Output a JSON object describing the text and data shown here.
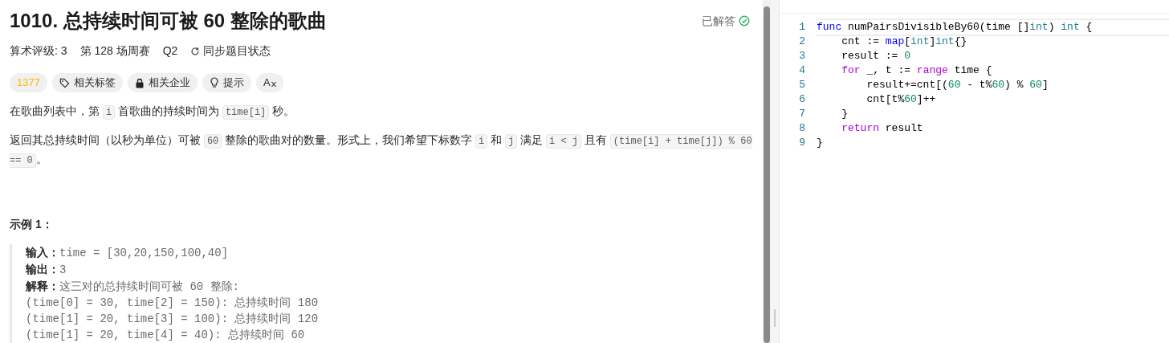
{
  "problem": {
    "title": "1010. 总持续时间可被 60 整除的歌曲",
    "status": "已解答",
    "meta": {
      "rating": "算术评级: 3",
      "contest": "第 128 场周赛",
      "question": "Q2",
      "sync": "同步题目状态"
    },
    "tags": [
      {
        "kind": "score",
        "label": "1377"
      },
      {
        "kind": "tag",
        "label": "相关标签"
      },
      {
        "kind": "lock",
        "label": "相关企业"
      },
      {
        "kind": "hint",
        "label": "提示"
      },
      {
        "kind": "translate",
        "label": "A"
      }
    ],
    "paragraphs": [
      [
        {
          "kind": "text",
          "text": "在歌曲列表中，第 "
        },
        {
          "kind": "code",
          "text": "i"
        },
        {
          "kind": "text",
          "text": " 首歌曲的持续时间为 "
        },
        {
          "kind": "code",
          "text": "time[i]"
        },
        {
          "kind": "text",
          "text": " 秒。"
        }
      ],
      [
        {
          "kind": "text",
          "text": "返回其总持续时间（以秒为单位）可被 "
        },
        {
          "kind": "code",
          "text": "60"
        },
        {
          "kind": "text",
          "text": " 整除的歌曲对的数量。形式上，我们希望下标数字 "
        },
        {
          "kind": "code",
          "text": "i"
        },
        {
          "kind": "text",
          "text": " 和 "
        },
        {
          "kind": "code",
          "text": "j"
        },
        {
          "kind": "text",
          "text": " 满足  "
        },
        {
          "kind": "code",
          "text": "i < j"
        },
        {
          "kind": "text",
          "text": " 且有 "
        },
        {
          "kind": "code",
          "text": "(time[i] + time[j]) % 60 == 0"
        },
        {
          "kind": "text",
          "text": "。"
        }
      ]
    ],
    "example": {
      "title": "示例 1：",
      "lines": [
        {
          "label": "输入：",
          "text": "time = [30,20,150,100,40]"
        },
        {
          "label": "输出：",
          "text": "3"
        },
        {
          "label": "解释：",
          "text": "这三对的总持续时间可被 60 整除:"
        },
        {
          "text": "(time[0] = 30, time[2] = 150): 总持续时间 180"
        },
        {
          "text": "(time[1] = 20, time[3] = 100): 总持续时间 120"
        },
        {
          "text": "(time[1] = 20, time[4] = 40): 总持续时间 60"
        }
      ]
    }
  },
  "editor": {
    "lines": [
      {
        "number": "1",
        "tokens": [
          {
            "kind": "keyword",
            "text": "func"
          },
          {
            "kind": "plain",
            "text": " numPairsDivisibleBy60(time []"
          },
          {
            "kind": "type",
            "text": "int"
          },
          {
            "kind": "plain",
            "text": ") "
          },
          {
            "kind": "type",
            "text": "int"
          },
          {
            "kind": "plain",
            "text": " {"
          }
        ]
      },
      {
        "number": "2",
        "tokens": [
          {
            "kind": "plain",
            "text": "    cnt := "
          },
          {
            "kind": "keyword",
            "text": "map"
          },
          {
            "kind": "plain",
            "text": "["
          },
          {
            "kind": "type",
            "text": "int"
          },
          {
            "kind": "plain",
            "text": "]"
          },
          {
            "kind": "type",
            "text": "int"
          },
          {
            "kind": "plain",
            "text": "{}"
          }
        ]
      },
      {
        "number": "3",
        "tokens": [
          {
            "kind": "plain",
            "text": "    result := "
          },
          {
            "kind": "number",
            "text": "0"
          }
        ]
      },
      {
        "number": "4",
        "tokens": [
          {
            "kind": "control",
            "text": "    for"
          },
          {
            "kind": "plain",
            "text": " _, t := "
          },
          {
            "kind": "control",
            "text": "range"
          },
          {
            "kind": "plain",
            "text": " time {"
          }
        ]
      },
      {
        "number": "5",
        "tokens": [
          {
            "kind": "plain",
            "text": "        result+=cnt[("
          },
          {
            "kind": "number",
            "text": "60"
          },
          {
            "kind": "plain",
            "text": " - t%"
          },
          {
            "kind": "number",
            "text": "60"
          },
          {
            "kind": "plain",
            "text": ") % "
          },
          {
            "kind": "number",
            "text": "60"
          },
          {
            "kind": "plain",
            "text": "]"
          }
        ]
      },
      {
        "number": "6",
        "tokens": [
          {
            "kind": "plain",
            "text": "        cnt[t%"
          },
          {
            "kind": "number",
            "text": "60"
          },
          {
            "kind": "plain",
            "text": "]++"
          }
        ]
      },
      {
        "number": "7",
        "tokens": [
          {
            "kind": "plain",
            "text": "    }"
          }
        ]
      },
      {
        "number": "8",
        "tokens": [
          {
            "kind": "control",
            "text": "    return"
          },
          {
            "kind": "plain",
            "text": " result"
          }
        ]
      },
      {
        "number": "9",
        "tokens": [
          {
            "kind": "plain",
            "text": "}"
          }
        ]
      }
    ]
  }
}
